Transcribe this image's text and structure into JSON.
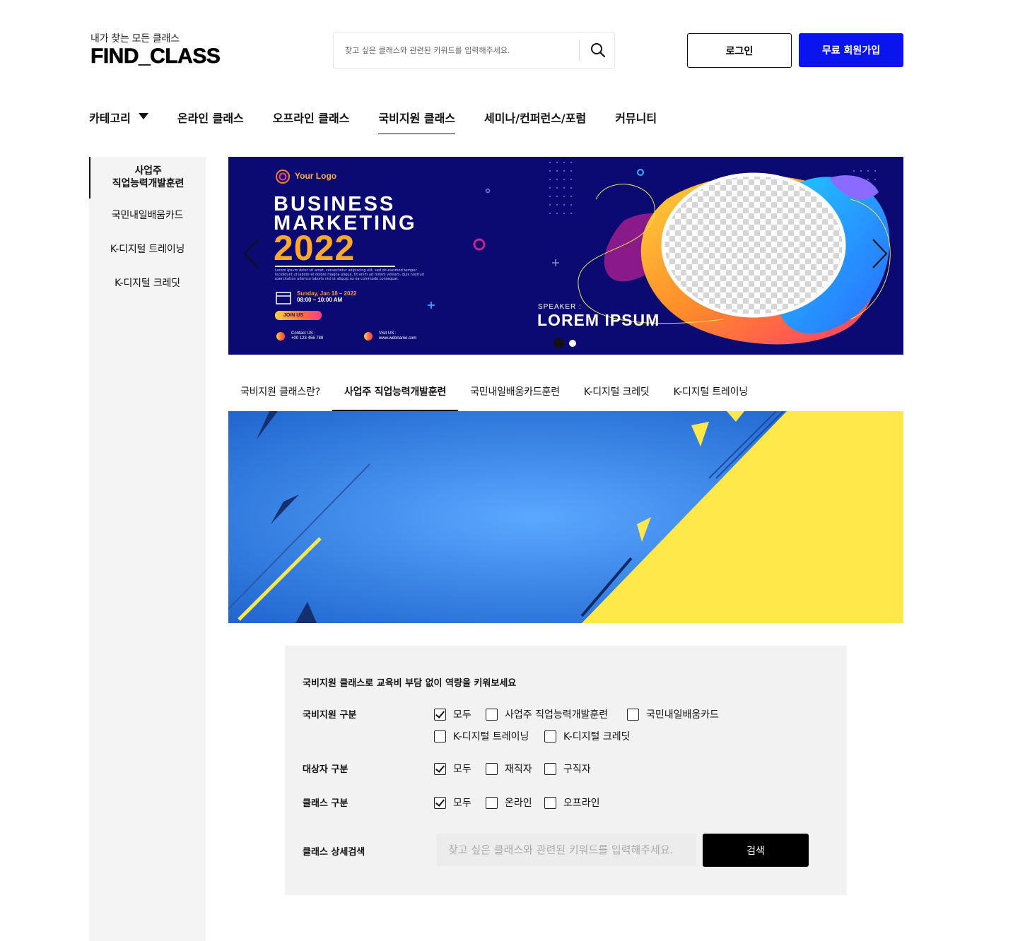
{
  "header": {
    "tagline": "내가 찾는 모든 클래스",
    "brand": "FIND_CLASS",
    "search_placeholder": "찾고 싶은 클래스와 관련된 키워드를 입력해주세요.",
    "search_icon": "search-icon",
    "login_label": "로그인",
    "join_label": "무료 회원가입",
    "colors": {
      "join_bg": "#0a14ef"
    }
  },
  "gnb": {
    "items": [
      {
        "label": "카테고리"
      },
      {
        "label": "온라인 클래스"
      },
      {
        "label": "오프라인 클래스"
      },
      {
        "label": "국비지원 클래스"
      },
      {
        "label": "세미나/컨퍼런스/포럼"
      },
      {
        "label": "커뮤니티"
      }
    ],
    "active_index": 3
  },
  "sidebar": {
    "items": [
      {
        "label": "사업주 직업능력개발훈련"
      },
      {
        "label": "국민내일배움카드"
      },
      {
        "label": "K-디지털 트레이닝"
      },
      {
        "label": "K-디지털 크레딧"
      }
    ],
    "active_index": 0
  },
  "hero": {
    "logo_text": "Your Logo",
    "line1": "BUSINESS",
    "line2": "MARKETING",
    "year": "2022",
    "lorem": "Lorem ipsum dolor sit amet, consectetur adipiscing elit, sed do eiusmod tempor incididunt ut labore et dolore magna aliqua. Ut enim ad minim veniam, quis nostrud exercitation ullamco laboris nisi ut aliquip ex ea commodo consequat.",
    "date": "Sunday, Jan 18 – 2022",
    "time": "08:00 – 10:00 AM",
    "join": "JOIN US",
    "contact_label": "Contact US :",
    "contact_value": "+00 123 456 789",
    "visit_label": "Visit US :",
    "visit_value": "www.webname.com",
    "speaker_label": "SPEAKER :",
    "speaker_name": "LOREM IPSUM",
    "slide_count": 2,
    "active_slide": 0
  },
  "tabs": {
    "items": [
      {
        "label": "국비지원 클래스란?"
      },
      {
        "label": "사업주 직업능력개발훈련"
      },
      {
        "label": "국민내일배움카드훈련"
      },
      {
        "label": "K-디지털 크레딧"
      },
      {
        "label": "K-디지털 트레이닝"
      }
    ],
    "active_index": 1
  },
  "filter": {
    "headline": "국비지원 클래스로 교육비 부담 없이 역량을 키워보세요",
    "groups": [
      {
        "label": "국비지원 구분",
        "options": [
          {
            "label": "모두",
            "checked": true
          },
          {
            "label": "사업주 직업능력개발훈련",
            "checked": false
          },
          {
            "label": "국민내일배움카드",
            "checked": false
          },
          {
            "label": "K-디지털 트레이닝",
            "checked": false
          },
          {
            "label": "K-디지털 크레딧",
            "checked": false
          }
        ]
      },
      {
        "label": "대상자 구분",
        "options": [
          {
            "label": "모두",
            "checked": true
          },
          {
            "label": "재직자",
            "checked": false
          },
          {
            "label": "구직자",
            "checked": false
          }
        ]
      },
      {
        "label": "클래스 구분",
        "options": [
          {
            "label": "모두",
            "checked": true
          },
          {
            "label": "온라인",
            "checked": false
          },
          {
            "label": "오프라인",
            "checked": false
          }
        ]
      }
    ],
    "detail_label": "클래스 상세검색",
    "detail_placeholder": "찾고 싶은 클래스와 관련된 키워드를 입력해주세요.",
    "search_label": "검색"
  }
}
